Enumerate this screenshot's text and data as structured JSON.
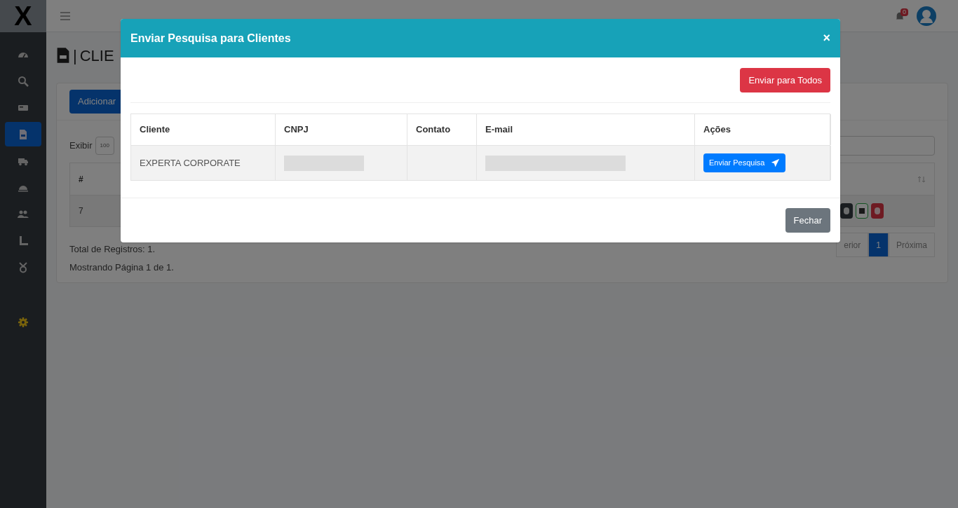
{
  "sidebar": {
    "logo": "X",
    "items": [
      {
        "selected": false
      },
      {
        "selected": false
      },
      {
        "selected": false
      },
      {
        "selected": true
      },
      {
        "selected": false
      },
      {
        "selected": false
      },
      {
        "selected": false
      },
      {
        "selected": false
      },
      {
        "selected": false
      },
      {
        "selected": false
      }
    ]
  },
  "header": {
    "notification_count": "0"
  },
  "page": {
    "title_separator": "|",
    "title": "CLIE",
    "add_button": "Adicionar",
    "show_label": "Exibir",
    "show_value": "100",
    "table": {
      "columns": [
        "#"
      ],
      "rows": [
        {
          "cells": [
            "7"
          ],
          "actions": [
            {
              "kind": "edge"
            },
            {
              "kind": "dark"
            },
            {
              "kind": "outline"
            },
            {
              "kind": "danger"
            }
          ]
        }
      ]
    },
    "total": "Total de Registros: 1.",
    "page_info": "Mostrando Página 1 de 1.",
    "pagination": [
      {
        "label": "erior",
        "selected": false
      },
      {
        "label": "1",
        "selected": true
      },
      {
        "label": "Próxima",
        "selected": false
      }
    ]
  },
  "modal": {
    "title": "Enviar Pesquisa para Clientes",
    "close": "×",
    "send_all": "Enviar para Todos",
    "columns": [
      "Cliente",
      "CNPJ",
      "Contato",
      "E-mail",
      "Ações"
    ],
    "rows": [
      {
        "cells": [
          {
            "kind": "text",
            "text": "EXPERTA CORPORATE"
          },
          {
            "kind": "redacted"
          },
          {
            "kind": "empty"
          },
          {
            "kind": "redacted"
          },
          {
            "kind": "action",
            "text": "Enviar Pesquisa"
          }
        ]
      }
    ],
    "close_button": "Fechar"
  }
}
